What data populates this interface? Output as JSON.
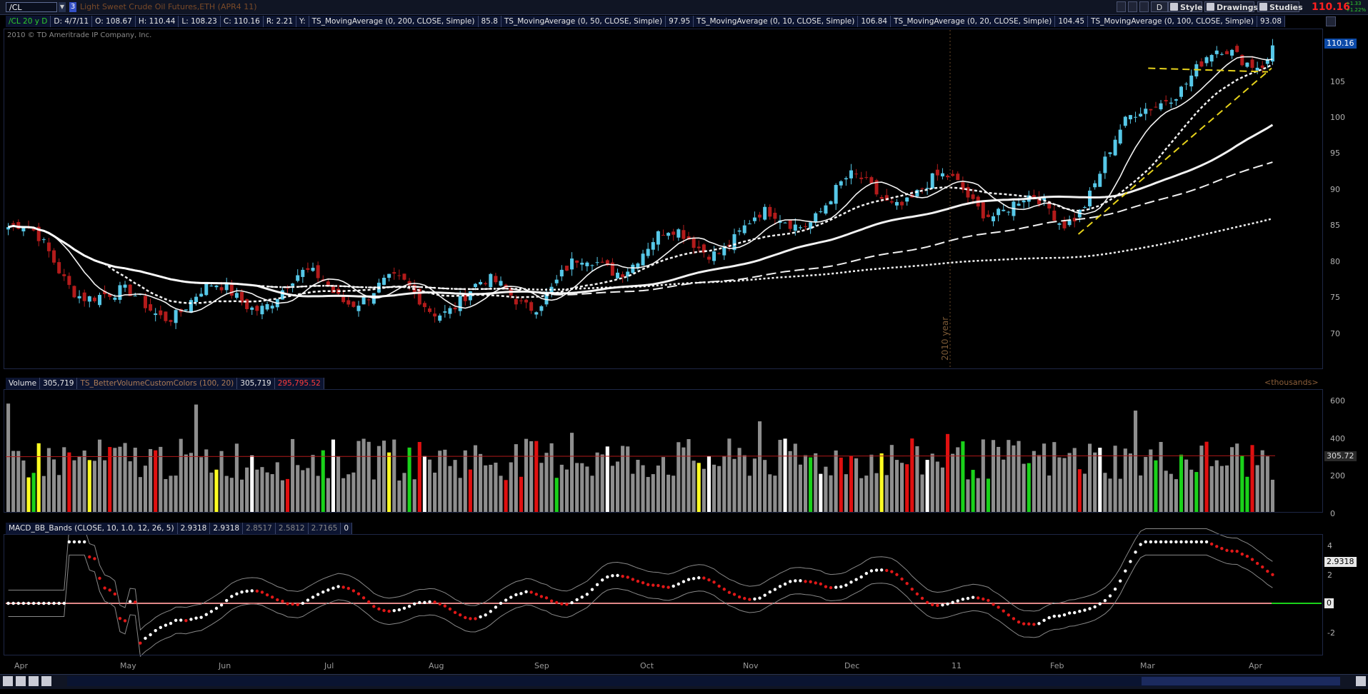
{
  "toolbar": {
    "symbol": "/CL",
    "group_number": "3",
    "description": "Light Sweet Crude Oil Futures,ETH (APR4 11)",
    "buttons": [
      "D",
      "Style",
      "Drawings",
      "Studies"
    ],
    "last_price": "110.16",
    "change_abs": "+1.33",
    "change_pct": "+1.22%"
  },
  "price_panel": {
    "info": [
      "/CL 20 y D",
      "D: 4/7/11",
      "O: 108.67",
      "H: 110.44",
      "L: 108.23",
      "C: 110.16",
      "R: 2.21",
      "Y:"
    ],
    "studies": [
      {
        "name": "TS_MovingAverage (0, 200, CLOSE, Simple)",
        "value": "85.8"
      },
      {
        "name": "TS_MovingAverage (0, 50, CLOSE, Simple)",
        "value": "97.95"
      },
      {
        "name": "TS_MovingAverage (0, 10, CLOSE, Simple)",
        "value": "106.84"
      },
      {
        "name": "TS_MovingAverage (0, 20, CLOSE, Simple)",
        "value": "104.45"
      },
      {
        "name": "TS_MovingAverage (0, 100, CLOSE, Simple)",
        "value": "93.08"
      }
    ],
    "copyright": "2010 © TD Ameritrade IP Company, Inc.",
    "axis_ticks": [
      "105",
      "100",
      "95",
      "90",
      "85",
      "80",
      "75",
      "70"
    ],
    "price_tag": "110.16",
    "year_marker": "2010 year"
  },
  "volume_panel": {
    "label": "Volume",
    "value": "305,719",
    "study": "TS_BetterVolumeCustomColors (100, 20)",
    "study_value": "305,719",
    "study_value2": "295,795.52",
    "units": "<thousands>",
    "axis_ticks": [
      "600",
      "400",
      "200",
      "0"
    ],
    "tag": "305.72"
  },
  "macd_panel": {
    "label": "MACD_BB_Bands (CLOSE, 10, 1.0, 12, 26, 5)",
    "values": [
      "2.9318",
      "2.9318",
      "2.8517",
      "2.5812",
      "2.7165",
      "0"
    ],
    "axis_ticks": [
      "4",
      "2",
      "0",
      "-2"
    ],
    "tag": "2.9318",
    "zero_tag": "0"
  },
  "x_axis": {
    "months": [
      "Apr",
      "May",
      "Jun",
      "Jul",
      "Aug",
      "Sep",
      "Oct",
      "Nov",
      "Dec",
      "11",
      "Feb",
      "Mar",
      "Apr"
    ]
  },
  "chart_data": {
    "type": "candlestick",
    "title": "/CL 20 y D",
    "xlabel": "",
    "ylabel": "",
    "ylim": [
      66,
      112
    ],
    "months": [
      "Apr",
      "May",
      "Jun",
      "Jul",
      "Aug",
      "Sep",
      "Oct",
      "Nov",
      "Dec",
      "11",
      "Feb",
      "Mar",
      "Apr"
    ],
    "close_monthly_approx": [
      {
        "month": "Apr",
        "value": 85
      },
      {
        "month": "May",
        "value": 74
      },
      {
        "month": "Jun",
        "value": 75
      },
      {
        "month": "Jul",
        "value": 77
      },
      {
        "month": "Aug",
        "value": 75
      },
      {
        "month": "Sep",
        "value": 76
      },
      {
        "month": "Oct",
        "value": 82
      },
      {
        "month": "Nov",
        "value": 84
      },
      {
        "month": "Dec",
        "value": 90
      },
      {
        "month": "11",
        "value": 90
      },
      {
        "month": "Feb",
        "value": 86
      },
      {
        "month": "Mar",
        "value": 105
      },
      {
        "month": "Apr",
        "value": 110.16
      }
    ],
    "moving_averages": [
      {
        "name": "TS_MovingAverage (0, 10, CLOSE, Simple)",
        "last": 106.84
      },
      {
        "name": "TS_MovingAverage (0, 20, CLOSE, Simple)",
        "last": 104.45
      },
      {
        "name": "TS_MovingAverage (0, 50, CLOSE, Simple)",
        "last": 97.95
      },
      {
        "name": "TS_MovingAverage (0, 100, CLOSE, Simple)",
        "last": 93.08
      },
      {
        "name": "TS_MovingAverage (0, 200, CLOSE, Simple)",
        "last": 85.8
      }
    ],
    "colors": {
      "up": "#56c8e8",
      "down": "#b31b1b",
      "ma": "#ffffff",
      "trend": "#e6d21b"
    }
  }
}
